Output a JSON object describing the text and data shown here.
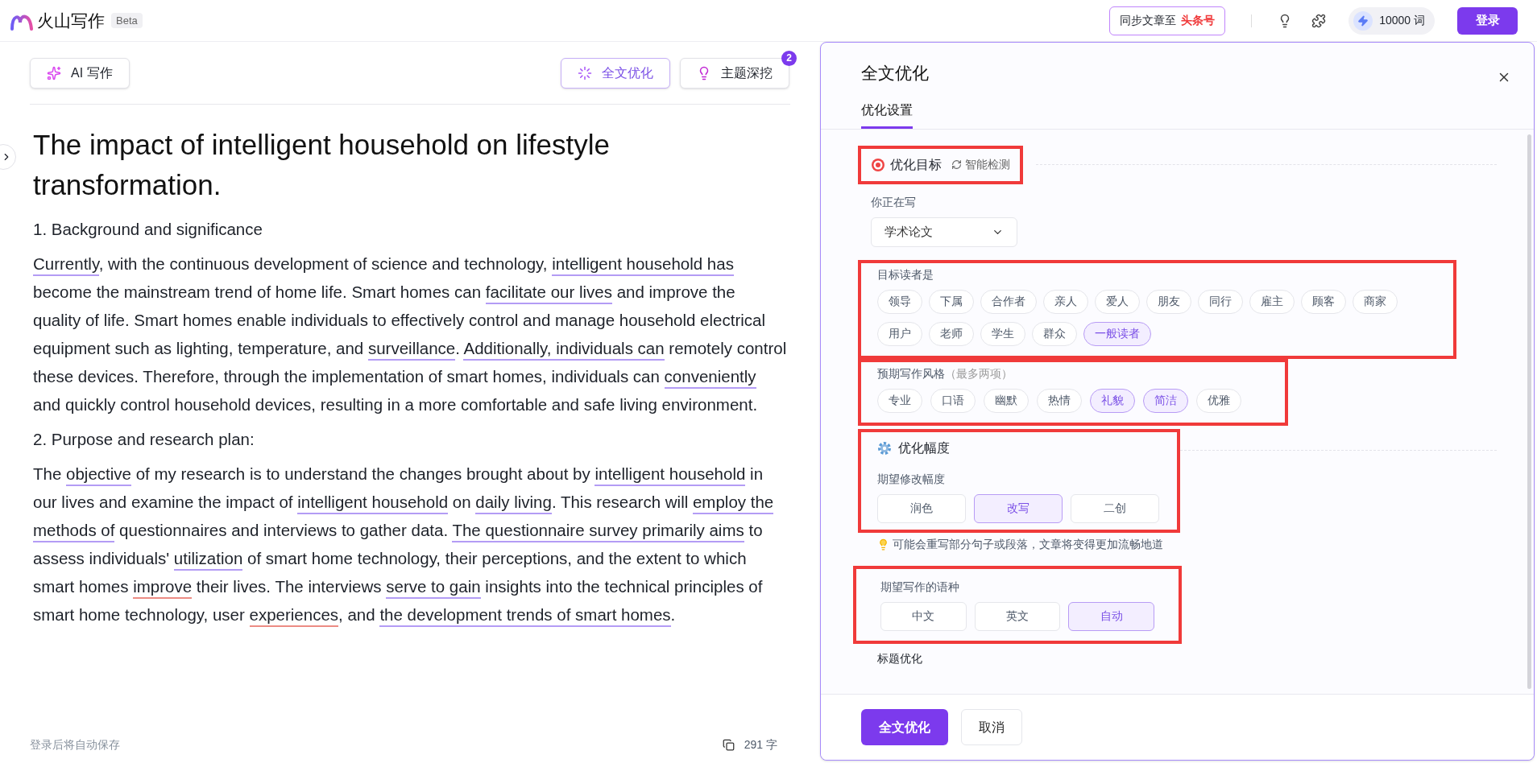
{
  "topbar": {
    "logo": "火山写作",
    "badge": "Beta",
    "sync": {
      "label": "同步文章至",
      "target": "头条号"
    },
    "credits": "10000 词",
    "login": "登录"
  },
  "toolbar": {
    "buttons": [
      {
        "label": "AI 写作",
        "kind": "ai",
        "selected": false
      },
      {
        "label": "全文优化",
        "kind": "optimize",
        "selected": true
      },
      {
        "label": "主题深挖",
        "kind": "topic",
        "selected": false,
        "count": "2"
      }
    ]
  },
  "article": {
    "title": "The impact of intelligent household on lifestyle transformation.",
    "blocks": [
      {
        "segments": [
          {
            "text": "1. Background and significance",
            "underlined": false
          }
        ]
      },
      {
        "segments": [
          {
            "text": "Currently",
            "underlined": true,
            "color": "#b39cf5"
          },
          {
            "text": ", with the continuous development of science and technology, ",
            "underlined": false
          },
          {
            "text": "intelligent household has",
            "underlined": true,
            "color": "#b39cf5"
          },
          {
            "text": " become the mainstream trend of home life. Smart homes can ",
            "underlined": false
          },
          {
            "text": "facilitate our lives",
            "underlined": true,
            "color": "#b39cf5"
          },
          {
            "text": " and improve the quality of life. Smart homes enable individuals to effectively control and manage household electrical equipment such as lighting, temperature, and ",
            "underlined": false
          },
          {
            "text": "surveillance",
            "underlined": true,
            "color": "#b39cf5"
          },
          {
            "text": ". ",
            "underlined": false
          },
          {
            "text": "Additionally, individuals can",
            "underlined": true,
            "color": "#b39cf5"
          },
          {
            "text": " remotely control these devices. Therefore, through the implementation of smart homes, individuals can ",
            "underlined": false
          },
          {
            "text": "conveniently",
            "underlined": true,
            "color": "#b39cf5"
          },
          {
            "text": " and quickly control household devices, resulting in a more comfortable and safe living environment.",
            "underlined": false
          }
        ]
      },
      {
        "segments": [
          {
            "text": "2. Purpose and research plan:",
            "underlined": false
          }
        ]
      },
      {
        "segments": [
          {
            "text": "The ",
            "underlined": false
          },
          {
            "text": "objective",
            "underlined": true,
            "color": "#b39cf5"
          },
          {
            "text": " of my research is to understand the changes brought about by ",
            "underlined": false
          },
          {
            "text": "intelligent household",
            "underlined": true,
            "color": "#b39cf5"
          },
          {
            "text": " in our lives and examine the impact of ",
            "underlined": false
          },
          {
            "text": "intelligent household",
            "underlined": true,
            "color": "#b39cf5"
          },
          {
            "text": " on ",
            "underlined": false
          },
          {
            "text": "daily living",
            "underlined": true,
            "color": "#b39cf5"
          },
          {
            "text": ". This research will ",
            "underlined": false
          },
          {
            "text": "employ the methods of",
            "underlined": true,
            "color": "#b39cf5"
          },
          {
            "text": " questionnaires and interviews to gather data. ",
            "underlined": false
          },
          {
            "text": "The questionnaire survey primarily aims",
            "underlined": true,
            "color": "#b39cf5"
          },
          {
            "text": " to assess individuals' ",
            "underlined": false
          },
          {
            "text": "utilization",
            "underlined": true,
            "color": "#b39cf5"
          },
          {
            "text": " of smart home technology, their perceptions, and the extent to which smart homes ",
            "underlined": false
          },
          {
            "text": "improve",
            "underlined": true,
            "color": "#ec8c84"
          },
          {
            "text": " their lives. The interviews ",
            "underlined": false
          },
          {
            "text": "serve to gain",
            "underlined": true,
            "color": "#b39cf5"
          },
          {
            "text": " insights into the technical principles of smart home technology, user ",
            "underlined": false
          },
          {
            "text": "experiences",
            "underlined": true,
            "color": "#ec8c84"
          },
          {
            "text": ", and ",
            "underlined": false
          },
          {
            "text": "the development trends of smart homes",
            "underlined": true,
            "color": "#b39cf5"
          },
          {
            "text": ".",
            "underlined": false
          }
        ]
      }
    ]
  },
  "footer": {
    "save_note": "登录后将自动保存",
    "count": "291 字"
  },
  "panel": {
    "title": "全文优化",
    "tabs": [
      {
        "label": "优化设置",
        "selected": true
      }
    ],
    "goal": {
      "title": "优化目标",
      "detect": "智能检测",
      "highlighted": true
    },
    "writing": {
      "label": "你正在写",
      "value": "学术论文"
    },
    "readers": {
      "label": "目标读者是",
      "highlighted": true,
      "options": [
        {
          "label": "领导",
          "selected": false
        },
        {
          "label": "下属",
          "selected": false
        },
        {
          "label": "合作者",
          "selected": false
        },
        {
          "label": "亲人",
          "selected": false
        },
        {
          "label": "爱人",
          "selected": false
        },
        {
          "label": "朋友",
          "selected": false
        },
        {
          "label": "同行",
          "selected": false
        },
        {
          "label": "雇主",
          "selected": false
        },
        {
          "label": "顾客",
          "selected": false
        },
        {
          "label": "商家",
          "selected": false
        },
        {
          "label": "用户",
          "selected": false
        },
        {
          "label": "老师",
          "selected": false
        },
        {
          "label": "学生",
          "selected": false
        },
        {
          "label": "群众",
          "selected": false
        },
        {
          "label": "一般读者",
          "selected": true
        }
      ]
    },
    "style": {
      "label": "预期写作风格",
      "note": "（最多两项）",
      "highlighted": true,
      "options": [
        {
          "label": "专业",
          "selected": false
        },
        {
          "label": "口语",
          "selected": false
        },
        {
          "label": "幽默",
          "selected": false
        },
        {
          "label": "热情",
          "selected": false
        },
        {
          "label": "礼貌",
          "selected": true
        },
        {
          "label": "简洁",
          "selected": true
        },
        {
          "label": "优雅",
          "selected": false
        }
      ]
    },
    "scope": {
      "title": "优化幅度",
      "label": "期望修改幅度",
      "highlighted": true,
      "options": [
        {
          "label": "润色",
          "selected": false
        },
        {
          "label": "改写",
          "selected": true
        },
        {
          "label": "二创",
          "selected": false
        }
      ]
    },
    "tip": "可能会重写部分句子或段落，文章将变得更加流畅地道",
    "language": {
      "label": "期望写作的语种",
      "highlighted": true,
      "options": [
        {
          "label": "中文",
          "selected": false
        },
        {
          "label": "英文",
          "selected": false
        },
        {
          "label": "自动",
          "selected": true
        }
      ]
    },
    "title_option": {
      "label": "标题优化"
    },
    "buttons": [
      {
        "label": "全文优化",
        "kind": "primary"
      },
      {
        "label": "取消",
        "kind": "secondary"
      }
    ]
  }
}
